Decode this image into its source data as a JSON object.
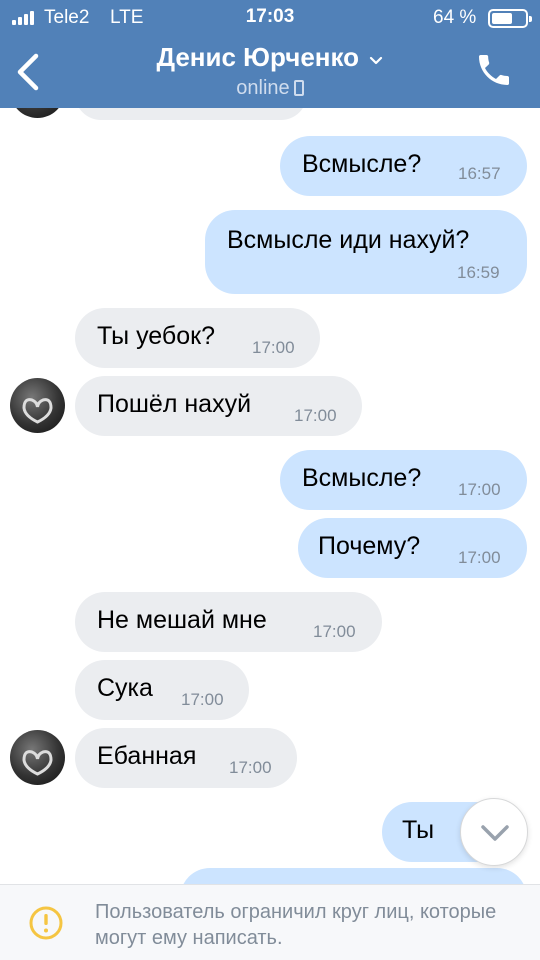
{
  "status_bar": {
    "carrier": "Tele2",
    "network": "LTE",
    "time": "17:03",
    "battery": "64 %",
    "battery_level": 0.64
  },
  "header": {
    "title": "Денис Юрченко",
    "status": "online",
    "icons": {
      "back": "chevron-left-icon",
      "call": "phone-icon",
      "dropdown": "chevron-down-icon"
    }
  },
  "messages": [
    {
      "dir": "out",
      "text": "Всмысле?",
      "time": "16:57"
    },
    {
      "dir": "out",
      "text": "Всмысле иди нахуй?",
      "time": "16:59"
    },
    {
      "dir": "in",
      "text": "Ты уебок?",
      "time": "17:00"
    },
    {
      "dir": "in",
      "text": "Пошёл нахуй",
      "time": "17:00"
    },
    {
      "dir": "out",
      "text": "Всмысле?",
      "time": "17:00"
    },
    {
      "dir": "out",
      "text": "Почему?",
      "time": "17:00"
    },
    {
      "dir": "in",
      "text": "Не мешай мне",
      "time": "17:00"
    },
    {
      "dir": "in",
      "text": "Сука",
      "time": "17:00"
    },
    {
      "dir": "in",
      "text": "Ебанная",
      "time": "17:00"
    },
    {
      "dir": "out",
      "text": "Ты",
      "time": ""
    }
  ],
  "footer": {
    "notice": "Пользователь ограничил круг лиц, которые могут ему написать.",
    "icon": "warning-icon",
    "accent": "#f5c542"
  },
  "colors": {
    "header": "#5181b8",
    "outgoing_bubble": "#cce4ff",
    "incoming_bubble": "#ebedf0",
    "time_text": "#818c99"
  }
}
